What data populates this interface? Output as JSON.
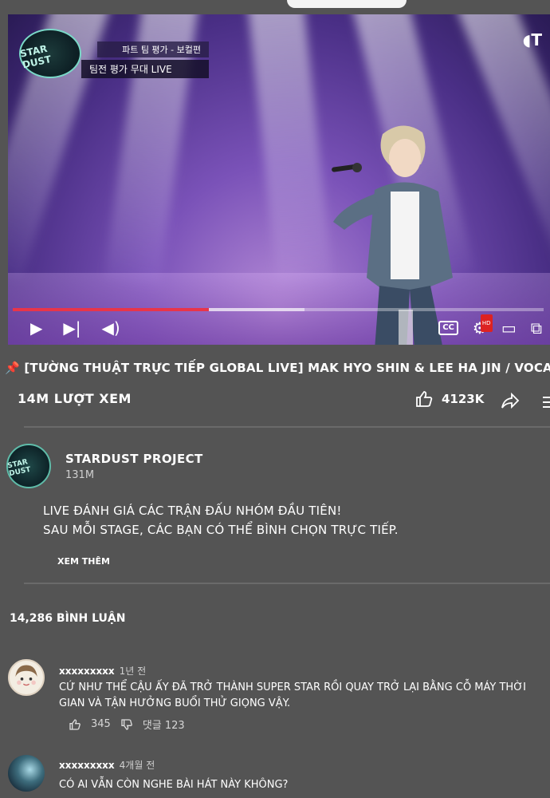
{
  "player": {
    "logo_text": "STAR DUST",
    "caption_line1": "파트 팀 평가 - 보컬편",
    "caption_line2": "팀전 평가 무대 LIVE",
    "watermark": "T",
    "progress_fraction": 0.37,
    "buffered_fraction": 0.55,
    "cc_label": "CC",
    "hd_label": "HD",
    "icons": [
      "play-icon",
      "next-icon",
      "volume-icon",
      "cc-icon",
      "settings-icon",
      "miniplayer-icon",
      "cast-icon"
    ],
    "accent_color": "#e8354a"
  },
  "video": {
    "title_prefix": "[",
    "title": "[TƯỜNG THUẬT TRỰC TIẾP GLOBAL LIVE] MAK HYO SHIN & LEE HA JIN / VOCAL",
    "views": "14M LƯỢT XEM",
    "likes": "4123K"
  },
  "channel": {
    "avatar_text": "STAR DUST",
    "name": "STARDUST PROJECT",
    "subscribers": "131M",
    "description_line1": "LIVE ĐÁNH GIÁ CÁC TRẬN ĐẤU NHÓM ĐẦU TIÊN!",
    "description_line2": "SAU MỖI STAGE, CÁC BẠN CÓ THỂ BÌNH CHỌN TRỰC TIẾP.",
    "see_more": "XEM THÊM"
  },
  "comments_header": "14,286 BÌNH LUẬN",
  "comments": [
    {
      "author": "xxxxxxxxx",
      "time": "1년 전",
      "text": "CỨ NHƯ THỂ CẬU ẤY ĐÃ TRỞ THÀNH SUPER STAR RỒI QUAY TRỞ LẠI BẰNG CỖ MÁY THỜI GIAN VÀ TẬN HƯỞNG BUỔI THỬ GIỌNG VẬY.",
      "likes": "345",
      "replies": "댓글 123"
    },
    {
      "author": "xxxxxxxxx",
      "time": "4개월 전",
      "text": "CÓ AI VẪN CÒN NGHE BÀI HÁT NÀY KHÔNG?"
    }
  ]
}
